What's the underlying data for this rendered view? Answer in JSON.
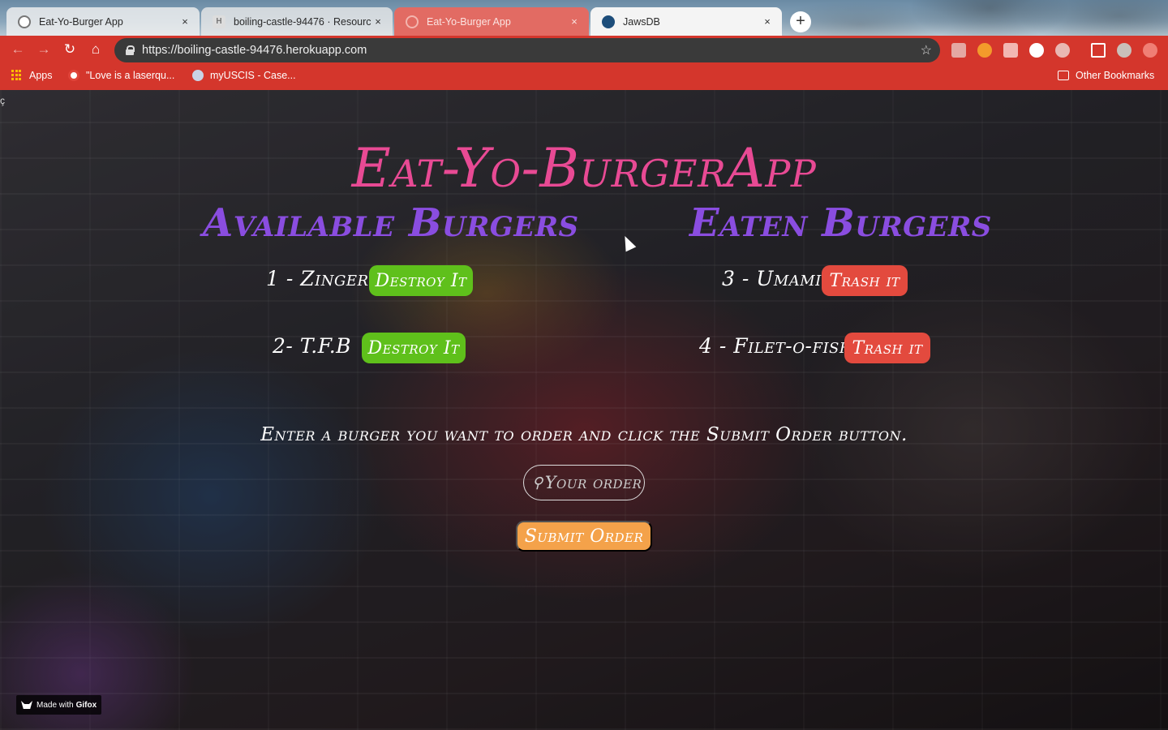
{
  "browser": {
    "tabs": [
      {
        "title": "Eat-Yo-Burger App",
        "favicon": "globe-icon",
        "active": false
      },
      {
        "title": "boiling-castle-94476 · Resourc",
        "favicon": "heroku-icon",
        "active": false
      },
      {
        "title": "Eat-Yo-Burger App",
        "favicon": "globe-icon",
        "active": false
      },
      {
        "title": "JawsDB",
        "favicon": "jawsdb-icon",
        "active": true
      }
    ],
    "new_tab_label": "+",
    "close_glyph": "×",
    "url": "https://boiling-castle-94476.herokuapp.com",
    "bookmarks": [
      {
        "label": "Apps",
        "icon": "apps-grid-icon"
      },
      {
        "label": "\"Love is a laserqu...",
        "icon": "bookmark-favicon-icon"
      },
      {
        "label": "myUSCIS - Case...",
        "icon": "uscis-seal-icon"
      }
    ],
    "other_bookmarks": "Other Bookmarks",
    "toolbar_color": "#d4362c"
  },
  "page": {
    "stray_glyph": "ç",
    "title": "Eat-Yo-BurgerApp",
    "available_heading": "Available Burgers",
    "eaten_heading": "Eaten Burgers",
    "available": [
      {
        "name": "1 - Zinger",
        "button": "Destroy It"
      },
      {
        "name": "2- T.F.B",
        "button": "Destroy It"
      }
    ],
    "eaten": [
      {
        "name": "3 - Umami",
        "button": "Trash it"
      },
      {
        "name": "4 - Filet-o-fish",
        "button": "Trash it"
      }
    ],
    "prompt": "Enter a burger you want to order and click the Submit Order button.",
    "input_placeholder": "Your order",
    "submit_label": "Submit Order",
    "colors": {
      "title": "#e84a94",
      "headings": "#8a4de0",
      "destroy_button": "#5fc01b",
      "trash_button": "#e34a3e",
      "submit_button": "#f4a24a"
    }
  },
  "badge": {
    "prefix": "Made with",
    "brand": "Gifox"
  }
}
